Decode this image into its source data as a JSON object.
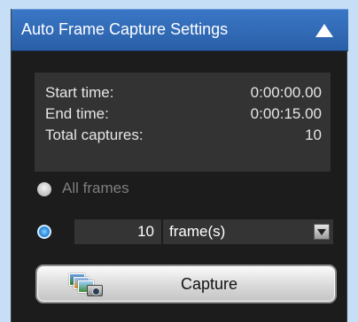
{
  "panel": {
    "title": "Auto Frame Capture Settings",
    "collapse_icon": "triangle-up-icon"
  },
  "info": {
    "start_time_label": "Start time:",
    "start_time_value": "0:00:00.00",
    "end_time_label": "End time:",
    "end_time_value": "0:00:15.00",
    "total_captures_label": "Total captures:",
    "total_captures_value": "10"
  },
  "options": {
    "all_frames_label": "All frames",
    "all_frames_selected": false,
    "every_n_selected": true,
    "frames_value": "10",
    "frames_unit_selected": "frame(s)"
  },
  "capture": {
    "label": "Capture",
    "icon": "capture-photos-camera-icon"
  },
  "colors": {
    "header_blue": "#2f68b5",
    "panel_bg": "#1c1c1c",
    "page_bg": "#c7dff6"
  }
}
